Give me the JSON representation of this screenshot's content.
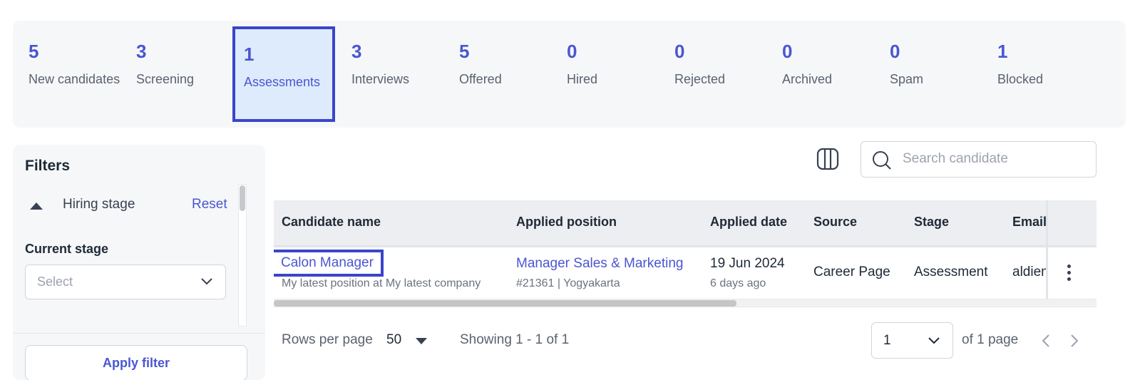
{
  "stages": [
    {
      "count": "5",
      "label": "New candidates"
    },
    {
      "count": "3",
      "label": "Screening"
    },
    {
      "count": "1",
      "label": "Assessments"
    },
    {
      "count": "3",
      "label": "Interviews"
    },
    {
      "count": "5",
      "label": "Offered"
    },
    {
      "count": "0",
      "label": "Hired"
    },
    {
      "count": "0",
      "label": "Rejected"
    },
    {
      "count": "0",
      "label": "Archived"
    },
    {
      "count": "0",
      "label": "Spam"
    },
    {
      "count": "1",
      "label": "Blocked"
    }
  ],
  "active_stage": "Assessments",
  "filters": {
    "title": "Filters",
    "hiring_stage_label": "Hiring stage",
    "reset_label": "Reset",
    "current_stage_label": "Current stage",
    "select_placeholder": "Select",
    "apply_label": "Apply filter"
  },
  "search": {
    "placeholder": "Search candidate"
  },
  "table": {
    "columns": [
      "Candidate name",
      "Applied position",
      "Applied date",
      "Source",
      "Stage",
      "Email"
    ],
    "rows": [
      {
        "name": "Calon Manager",
        "subtitle": "My latest position at My latest company",
        "position": "Manager Sales & Marketing",
        "position_sub": "#21361 | Yogyakarta",
        "date": "19 Jun 2024",
        "date_sub": "6 days ago",
        "source": "Career Page",
        "stage": "Assessment",
        "email": "aldien"
      }
    ]
  },
  "pagination": {
    "rows_per_page_label": "Rows per page",
    "rows_per_page": "50",
    "showing": "Showing 1 - 1 of 1",
    "page": "1",
    "of_pages": "of 1 page"
  },
  "colors": {
    "accent": "#4a56d1",
    "highlight": "#3a45c9",
    "active_bg": "#deebfd"
  }
}
